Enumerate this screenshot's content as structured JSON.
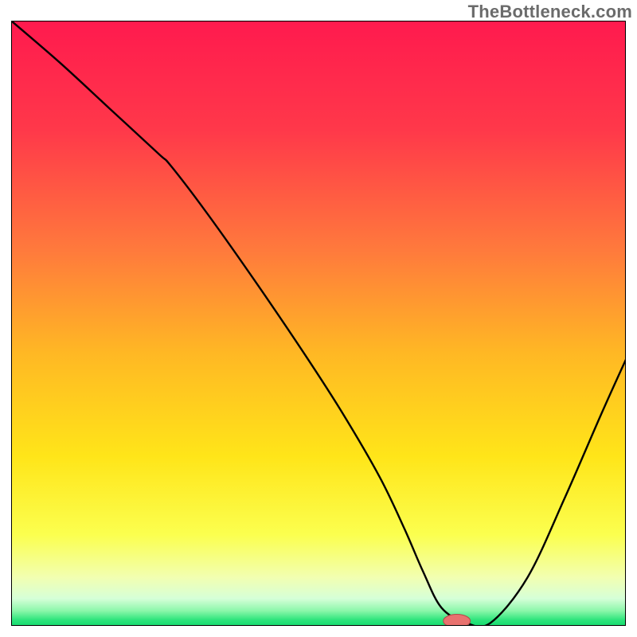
{
  "watermark": "TheBottleneck.com",
  "chart_data": {
    "type": "line",
    "title": "",
    "xlabel": "",
    "ylabel": "",
    "xlim": [
      0,
      100
    ],
    "ylim": [
      0,
      100
    ],
    "grid": false,
    "legend": false,
    "gradient_stops": [
      {
        "offset": 0.0,
        "color": "#ff1a4e"
      },
      {
        "offset": 0.18,
        "color": "#ff384a"
      },
      {
        "offset": 0.38,
        "color": "#ff7a3c"
      },
      {
        "offset": 0.55,
        "color": "#ffb824"
      },
      {
        "offset": 0.72,
        "color": "#ffe519"
      },
      {
        "offset": 0.85,
        "color": "#fbff4f"
      },
      {
        "offset": 0.92,
        "color": "#f2ffb1"
      },
      {
        "offset": 0.955,
        "color": "#d6ffd8"
      },
      {
        "offset": 0.975,
        "color": "#8cf7aa"
      },
      {
        "offset": 0.99,
        "color": "#2ee57c"
      },
      {
        "offset": 1.0,
        "color": "#16db6f"
      }
    ],
    "series": [
      {
        "name": "bottleneck-curve",
        "x": [
          0.0,
          8.0,
          16.0,
          24.0,
          26.0,
          32.0,
          40.0,
          48.0,
          54.0,
          60.0,
          64.0,
          67.0,
          70.0,
          74.0,
          78.0,
          84.0,
          90.0,
          96.0,
          100.0
        ],
        "y": [
          100.0,
          93.0,
          85.5,
          78.0,
          76.0,
          68.0,
          56.5,
          44.5,
          35.0,
          24.5,
          16.0,
          9.0,
          3.0,
          0.5,
          0.5,
          8.0,
          21.0,
          35.0,
          44.0
        ],
        "color": "#000000",
        "stroke_width": 2.4
      }
    ],
    "marker": {
      "x": 72.5,
      "y": 0.8,
      "rx": 2.2,
      "ry": 1.1,
      "fill": "#e8726f",
      "stroke": "#b24a49"
    },
    "frame": {
      "stroke": "#000000",
      "stroke_width": 2
    }
  }
}
